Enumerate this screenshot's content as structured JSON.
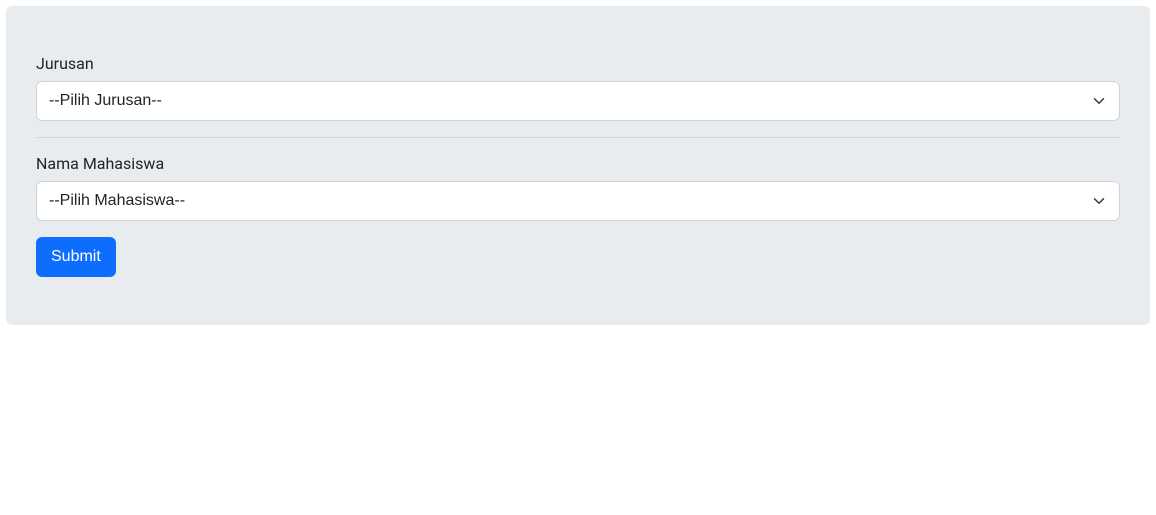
{
  "form": {
    "jurusan": {
      "label": "Jurusan",
      "selected": "--Pilih Jurusan--"
    },
    "mahasiswa": {
      "label": "Nama Mahasiswa",
      "selected": "--Pilih Mahasiswa--"
    },
    "submit_label": "Submit"
  }
}
